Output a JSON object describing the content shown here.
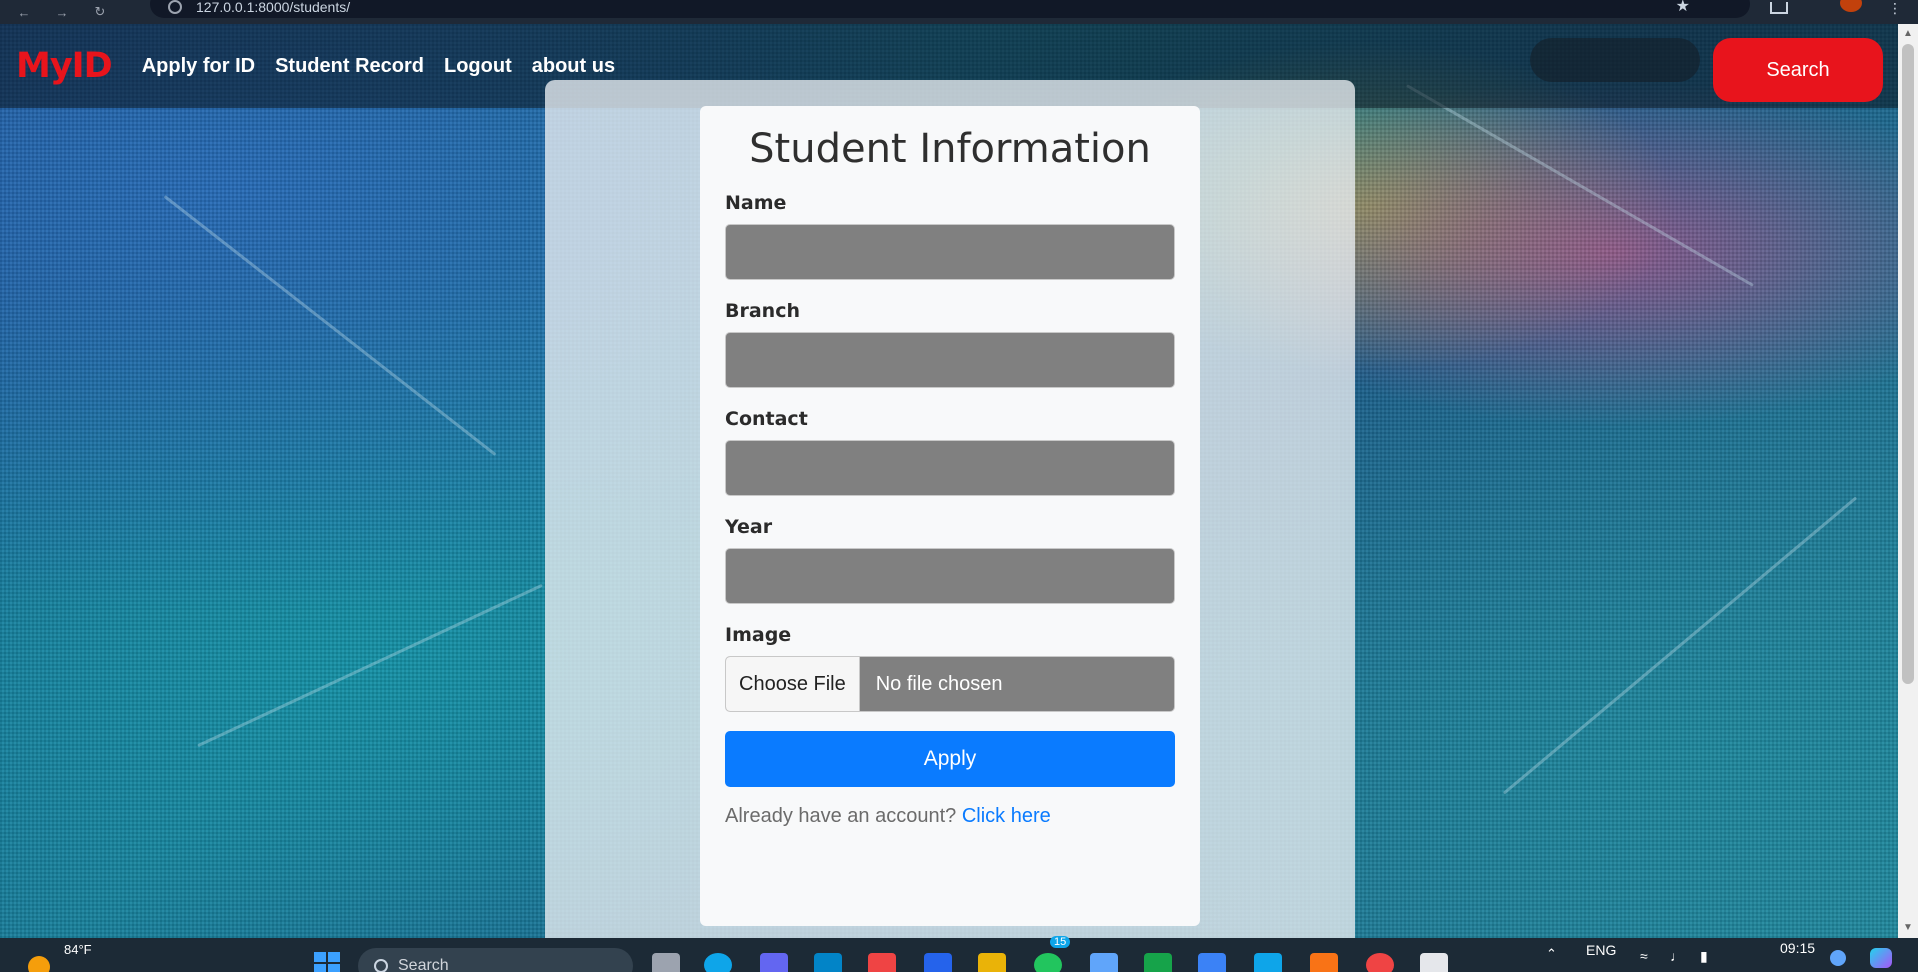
{
  "browser": {
    "url": "127.0.0.1:8000/students/"
  },
  "navbar": {
    "brand": "MyID",
    "links": [
      "Apply for ID",
      "Student Record",
      "Logout",
      "about us"
    ],
    "search_button": "Search"
  },
  "form": {
    "title": "Student Information",
    "fields": {
      "name_label": "Name",
      "branch_label": "Branch",
      "contact_label": "Contact",
      "year_label": "Year",
      "image_label": "Image"
    },
    "file_button": "Choose File",
    "file_status": "No file chosen",
    "submit": "Apply",
    "account_prompt": "Already have an account?",
    "account_link": "Click here"
  },
  "taskbar": {
    "temperature": "84°F",
    "search": "Search",
    "language": "ENG",
    "time": "09:15",
    "notification_badge": "15"
  },
  "colors": {
    "brand_red": "#e8141c",
    "apply_blue": "#0a7bff",
    "input_gray": "#808080"
  }
}
